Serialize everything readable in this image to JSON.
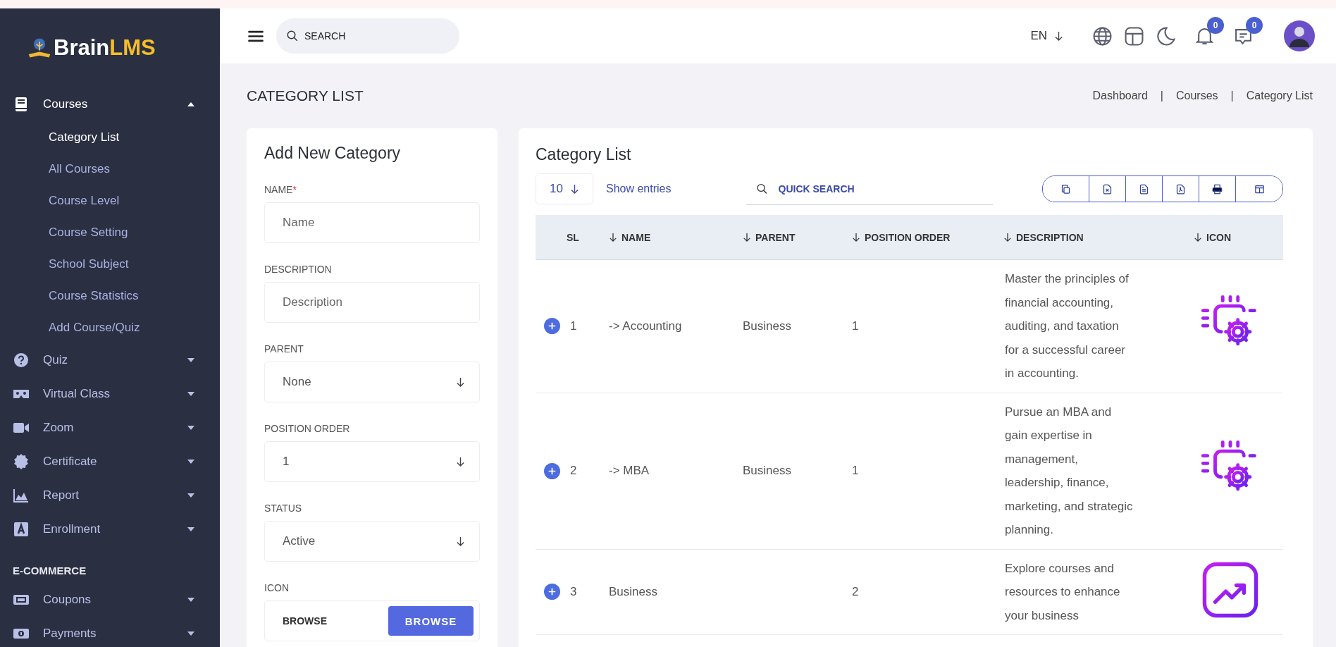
{
  "sidebar": {
    "logo": {
      "part_1": "Brain",
      "part_2": "LMS"
    },
    "groups": [
      {
        "items": [
          {
            "label": "Courses",
            "expanded": true,
            "children": [
              {
                "label": "Category List",
                "selected": true
              },
              {
                "label": "All Courses",
                "selected": false
              },
              {
                "label": "Course Level",
                "selected": false
              },
              {
                "label": "Course Setting",
                "selected": false
              },
              {
                "label": "School Subject",
                "selected": false
              },
              {
                "label": "Course Statistics",
                "selected": false
              },
              {
                "label": "Add Course/Quiz",
                "selected": false
              }
            ]
          },
          {
            "label": "Quiz",
            "expanded": false
          },
          {
            "label": "Virtual Class",
            "expanded": false
          },
          {
            "label": "Zoom",
            "expanded": false
          },
          {
            "label": "Certificate",
            "expanded": false
          },
          {
            "label": "Report",
            "expanded": false
          },
          {
            "label": "Enrollment",
            "expanded": false
          }
        ]
      },
      {
        "heading": "E-COMMERCE",
        "items": [
          {
            "label": "Coupons",
            "expanded": false
          },
          {
            "label": "Payments",
            "expanded": false
          }
        ]
      }
    ]
  },
  "topbar": {
    "search": {
      "placeholder": "SEARCH"
    },
    "language": "EN",
    "notifications": {
      "count": "0"
    },
    "messages": {
      "count": "0"
    }
  },
  "page": {
    "title": "CATEGORY LIST",
    "breadcrumb": {
      "separator": "|",
      "items": [
        "Dashboard",
        "Courses",
        "Category List"
      ]
    }
  },
  "form": {
    "title": "Add New Category",
    "fields": [
      {
        "kind": "text",
        "label": "NAME",
        "required_mark": "*",
        "placeholder": "Name"
      },
      {
        "kind": "text",
        "label": "DESCRIPTION",
        "placeholder": "Description"
      },
      {
        "kind": "select",
        "label": "PARENT",
        "value": "None"
      },
      {
        "kind": "select",
        "label": "POSITION ORDER",
        "value": "1"
      },
      {
        "kind": "select",
        "label": "STATUS",
        "value": "Active"
      },
      {
        "kind": "file",
        "label": "ICON",
        "value": "BROWSE",
        "button": "BROWSE"
      }
    ]
  },
  "table": {
    "title": "Category List",
    "page_size": "10",
    "show_entries": "Show entries",
    "search": {
      "placeholder": "QUICK SEARCH"
    },
    "columns": [
      {
        "label": "SL",
        "sortable": false
      },
      {
        "label": "NAME",
        "sortable": true
      },
      {
        "label": "PARENT",
        "sortable": true
      },
      {
        "label": "POSITION ORDER",
        "sortable": true
      },
      {
        "label": "DESCRIPTION",
        "sortable": true
      },
      {
        "label": "ICON",
        "sortable": true
      }
    ],
    "rows": [
      {
        "sl": "1",
        "name": "-> Accounting",
        "parent": "Business",
        "position_order": "1",
        "description": "Master the principles of financial accounting, auditing, and taxation for a successful career in accounting."
      },
      {
        "sl": "2",
        "name": "-> MBA",
        "parent": "Business",
        "position_order": "1",
        "description": "Pursue an MBA and gain expertise in management, leadership, finance, marketing, and strategic planning."
      },
      {
        "sl": "3",
        "name": "Business",
        "parent": "",
        "position_order": "2",
        "description": "Explore courses and resources to enhance your business"
      }
    ]
  }
}
